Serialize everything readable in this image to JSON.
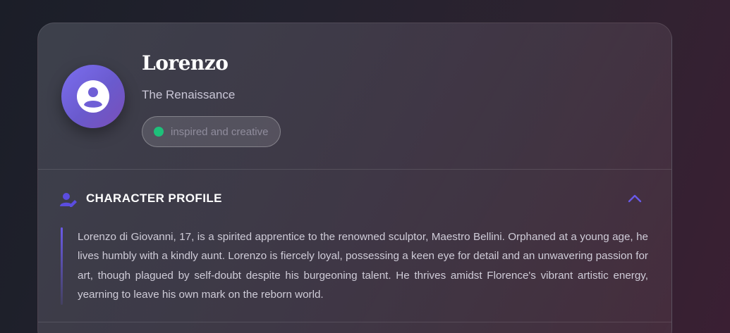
{
  "character": {
    "name": "Lorenzo",
    "era": "The Renaissance",
    "mood": "inspired and creative",
    "mood_color": "#1ec07a"
  },
  "profile_section": {
    "title": "CHARACTER PROFILE",
    "icon": "user-edit-icon",
    "toggle_icon": "chevron-up-icon",
    "expanded": true,
    "description": "Lorenzo di Giovanni, 17, is a spirited apprentice to the renowned sculptor, Maestro Bellini. Orphaned at a young age, he lives humbly with a kindly aunt. Lorenzo is fiercely loyal, possessing a keen eye for detail and an unwavering passion for art, though plagued by self-doubt despite his burgeoning talent. He thrives amidst Florence's vibrant artistic energy, yearning to leave his own mark on the reborn world."
  },
  "colors": {
    "accent": "#6a5ae8",
    "avatar_gradient": [
      "#7b6ef0",
      "#7a4fb8"
    ]
  }
}
